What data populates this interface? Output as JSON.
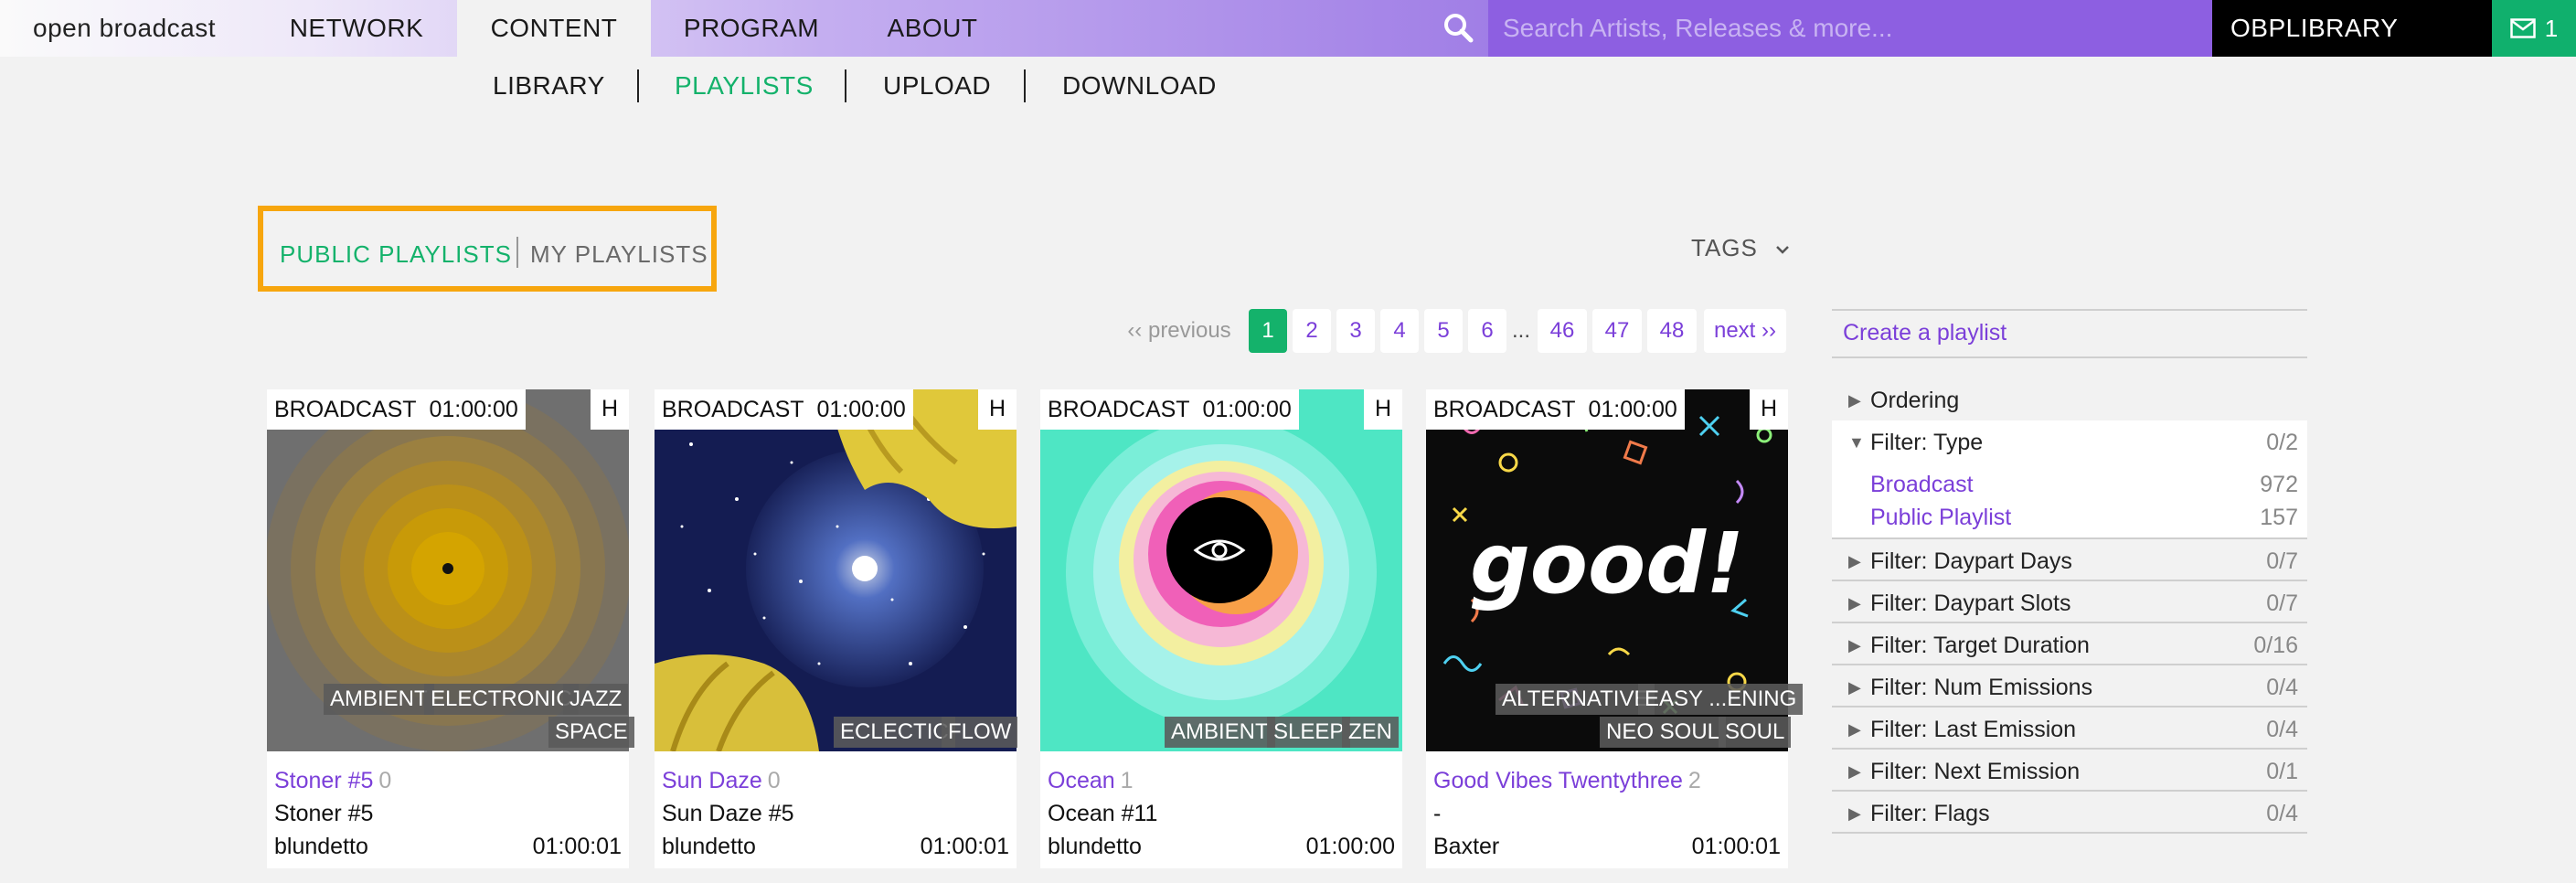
{
  "topbar": {
    "brand": "open broadcast",
    "nav": [
      "NETWORK",
      "CONTENT",
      "PROGRAM",
      "ABOUT"
    ],
    "active_nav": "CONTENT",
    "search_placeholder": "Search Artists, Releases & more...",
    "library_button": "OBPLIBRARY",
    "mail_count": "1",
    "colors": {
      "accent": "#8d5fe1",
      "green": "#14b26b"
    }
  },
  "subnav": {
    "items": [
      "LIBRARY",
      "PLAYLISTS",
      "UPLOAD",
      "DOWNLOAD"
    ],
    "active": "PLAYLISTS"
  },
  "tabs": {
    "public": "PUBLIC PLAYLISTS",
    "mine": "MY PLAYLISTS",
    "tags": "TAGS"
  },
  "pagination": {
    "previous": "‹‹ previous",
    "pages": [
      "1",
      "2",
      "3",
      "4",
      "5",
      "6",
      "46",
      "47",
      "48"
    ],
    "ellipsis": "...",
    "next": "next ››",
    "current": "1"
  },
  "cards": [
    {
      "type": "BROADCAST",
      "length": "01:00:00",
      "badge": "H",
      "tags": [
        "AMBIENT",
        "ELECTRONIC",
        "JAZZ",
        "SPACE"
      ],
      "title": "Stoner #5",
      "count": "0",
      "description": "Stoner #5",
      "owner": "blundetto",
      "duration": "01:00:01"
    },
    {
      "type": "BROADCAST",
      "length": "01:00:00",
      "badge": "H",
      "tags": [
        "ECLECTIC",
        "FLOW"
      ],
      "title": "Sun Daze",
      "count": "0",
      "description": "Sun Daze #5",
      "owner": "blundetto",
      "duration": "01:00:01"
    },
    {
      "type": "BROADCAST",
      "length": "01:00:00",
      "badge": "H",
      "tags": [
        "AMBIENT",
        "SLEEP",
        "ZEN"
      ],
      "title": "Ocean",
      "count": "1",
      "description": "Ocean #11",
      "owner": "blundetto",
      "duration": "01:00:00"
    },
    {
      "type": "BROADCAST",
      "length": "01:00:00",
      "badge": "H",
      "tags": [
        "ALTERNATIVE",
        "EASY ...ENING",
        "NEO SOUL",
        "SOUL"
      ],
      "title": "Good Vibes Twentythree",
      "count": "2",
      "description": "-",
      "owner": "Baxter",
      "duration": "01:00:01",
      "art_text": "good!"
    }
  ],
  "sidebar": {
    "create": "Create a playlist",
    "filters": [
      {
        "name": "Ordering",
        "count": ""
      },
      {
        "name": "Filter: Type",
        "count": "0/2",
        "open": true,
        "options": [
          {
            "label": "Broadcast",
            "count": "972"
          },
          {
            "label": "Public Playlist",
            "count": "157"
          }
        ]
      },
      {
        "name": "Filter: Daypart Days",
        "count": "0/7"
      },
      {
        "name": "Filter: Daypart Slots",
        "count": "0/7"
      },
      {
        "name": "Filter: Target Duration",
        "count": "0/16"
      },
      {
        "name": "Filter: Num Emissions",
        "count": "0/4"
      },
      {
        "name": "Filter: Last Emission",
        "count": "0/4"
      },
      {
        "name": "Filter: Next Emission",
        "count": "0/1"
      },
      {
        "name": "Filter: Flags",
        "count": "0/4"
      }
    ]
  }
}
